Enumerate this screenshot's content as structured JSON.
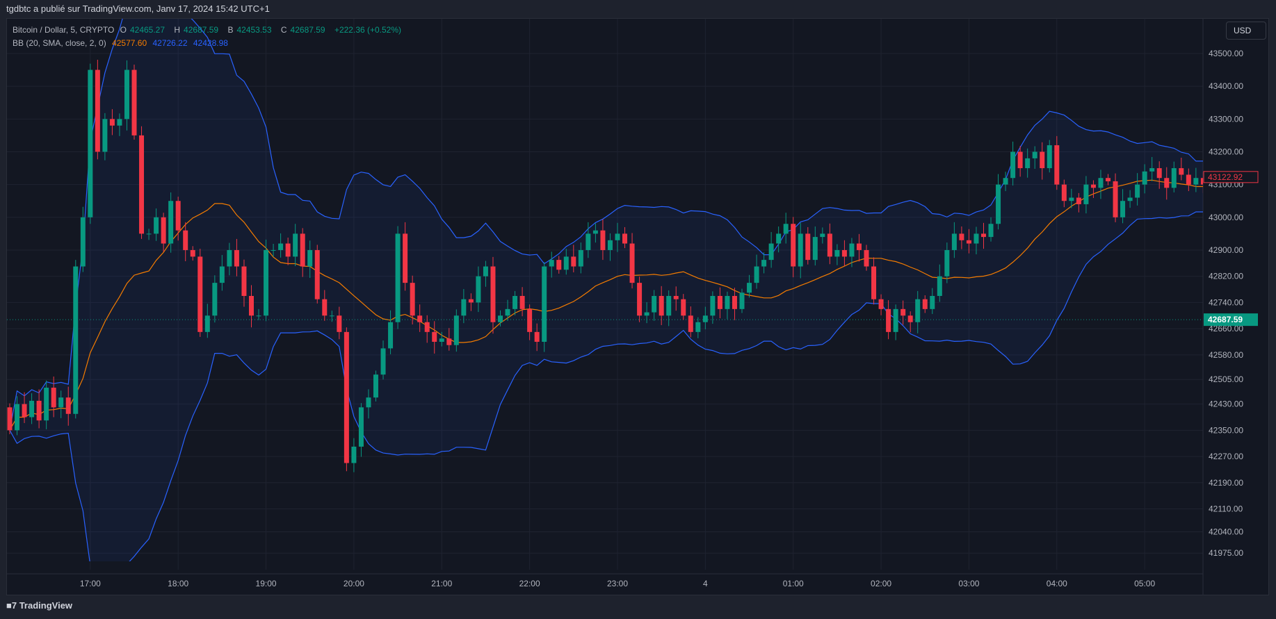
{
  "header": {
    "published": "tgdbtc a publié sur TradingView.com, Janv 17, 2024 15:42 UTC+1"
  },
  "legend": {
    "symbol": "Bitcoin / Dollar, 5, CRYPTO",
    "o_label": "O",
    "o": "42465.27",
    "h_label": "H",
    "h": "42687.59",
    "b_label": "B",
    "b": "42453.53",
    "c_label": "C",
    "c": "42687.59",
    "change": "+222.36 (+0.52%)",
    "bb_label": "BB (20, SMA, close, 2, 0)",
    "bb_basis": "42577.60",
    "bb_upper": "42726.22",
    "bb_lower": "42428.98"
  },
  "currency_button": "USD",
  "footer": {
    "brand": "TradingView"
  },
  "colors": {
    "up": "#089981",
    "down": "#f23645",
    "basis": "#f57c00",
    "bands": "#2962ff",
    "background": "#131722"
  },
  "chart_data": {
    "type": "candlestick",
    "symbol": "Bitcoin / Dollar",
    "interval_minutes": 5,
    "first_bar_time": "16:05",
    "indicator": "Bollinger Bands (20, SMA, close, 2)",
    "ylim": [
      41940,
      43600
    ],
    "y_ticks": [
      "43500.00",
      "43400.00",
      "43300.00",
      "43200.00",
      "43100.00",
      "43000.00",
      "42900.00",
      "42820.00",
      "42740.00",
      "42660.00",
      "42580.00",
      "42505.00",
      "42430.00",
      "42350.00",
      "42270.00",
      "42190.00",
      "42110.00",
      "42040.00",
      "41975.00"
    ],
    "x_ticks": [
      {
        "label": "17:00",
        "bar": 11
      },
      {
        "label": "18:00",
        "bar": 23
      },
      {
        "label": "19:00",
        "bar": 35
      },
      {
        "label": "20:00",
        "bar": 47
      },
      {
        "label": "21:00",
        "bar": 59
      },
      {
        "label": "22:00",
        "bar": 71
      },
      {
        "label": "23:00",
        "bar": 83
      },
      {
        "label": "4",
        "bar": 95
      },
      {
        "label": "01:00",
        "bar": 107
      },
      {
        "label": "02:00",
        "bar": 119
      },
      {
        "label": "03:00",
        "bar": 131
      },
      {
        "label": "04:00",
        "bar": 143
      },
      {
        "label": "05:00",
        "bar": 155
      }
    ],
    "first_open": 42420,
    "close": [
      42350,
      42430,
      42390,
      42440,
      42380,
      42480,
      42420,
      42450,
      42400,
      42850,
      43000,
      43450,
      43200,
      43300,
      43280,
      43300,
      43450,
      43250,
      42950,
      42950,
      43000,
      42920,
      43050,
      42960,
      42900,
      42880,
      42650,
      42700,
      42800,
      42850,
      42900,
      42850,
      42760,
      42700,
      42700,
      42900,
      42900,
      42920,
      42880,
      42950,
      42850,
      42900,
      42750,
      42700,
      42700,
      42650,
      42250,
      42300,
      42420,
      42450,
      42520,
      42600,
      42680,
      42950,
      42800,
      42700,
      42680,
      42650,
      42620,
      42630,
      42610,
      42700,
      42750,
      42740,
      42820,
      42850,
      42680,
      42700,
      42720,
      42760,
      42720,
      42650,
      42620,
      42850,
      42870,
      42840,
      42880,
      42850,
      42900,
      42950,
      42960,
      42900,
      42930,
      42950,
      42920,
      42800,
      42700,
      42710,
      42760,
      42700,
      42760,
      42750,
      42700,
      42650,
      42680,
      42700,
      42760,
      42720,
      42760,
      42720,
      42770,
      42800,
      42850,
      42870,
      42920,
      42950,
      42980,
      42850,
      42950,
      42870,
      42940,
      42950,
      42880,
      42900,
      42880,
      42920,
      42900,
      42850,
      42750,
      42720,
      42650,
      42720,
      42700,
      42680,
      42750,
      42720,
      42760,
      42820,
      42900,
      42950,
      42930,
      42920,
      42950,
      42940,
      42980,
      43100,
      43120,
      43200,
      43150,
      43180,
      43200,
      43150,
      43220,
      43100,
      43050,
      43060,
      43040,
      43100,
      43090,
      43120,
      43110,
      43000,
      43050,
      43060,
      43100,
      43140,
      43150,
      43120,
      43090,
      43150,
      43130,
      43100,
      43120,
      43100,
      43200,
      43122.92
    ],
    "last_price_label": "43122.92",
    "marked_price_label": "42687.59"
  }
}
